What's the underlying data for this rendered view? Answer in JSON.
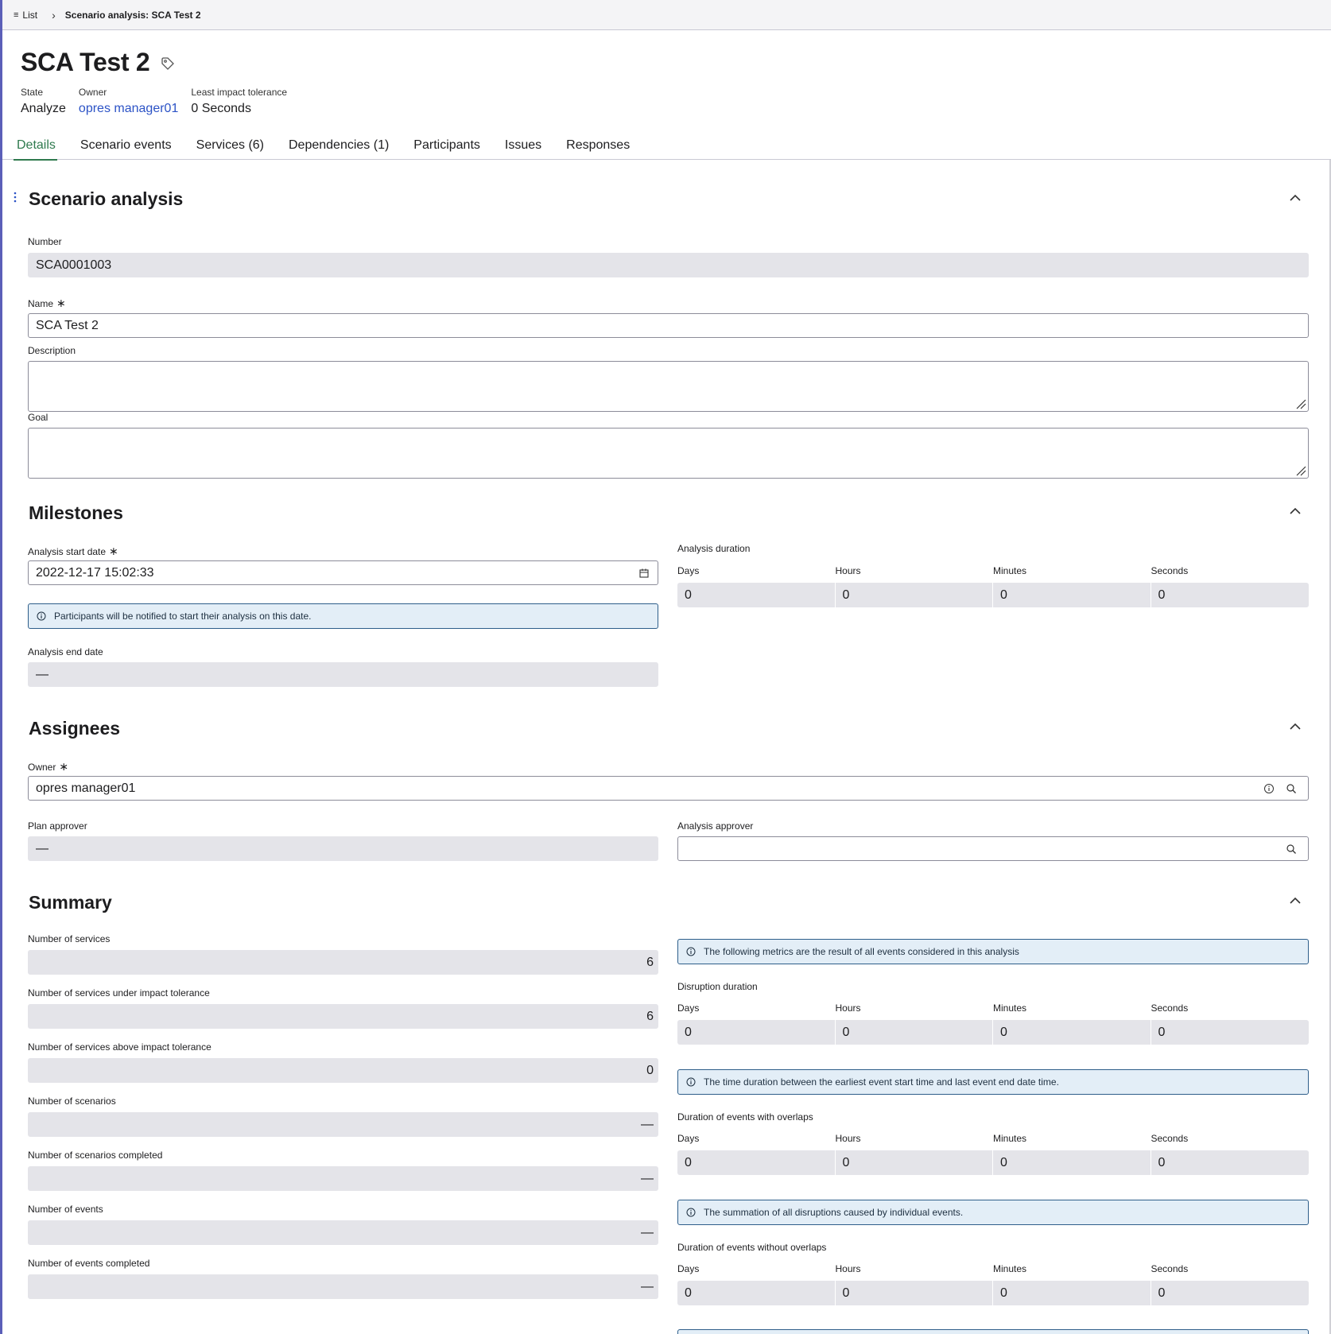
{
  "breadcrumb": {
    "list_label": "List",
    "current": "Scenario analysis: SCA Test 2"
  },
  "header": {
    "title": "SCA Test 2",
    "meta": [
      {
        "label": "State",
        "value": "Analyze"
      },
      {
        "label": "Owner",
        "value": "opres manager01"
      },
      {
        "label": "Least impact tolerance",
        "value": "0 Seconds"
      }
    ]
  },
  "tabs": [
    "Details",
    "Scenario events",
    "Services (6)",
    "Dependencies (1)",
    "Participants",
    "Issues",
    "Responses"
  ],
  "scenario_analysis": {
    "title": "Scenario analysis",
    "number_label": "Number",
    "number_value": "SCA0001003",
    "name_label": "Name",
    "name_value": "SCA Test 2",
    "description_label": "Description",
    "goal_label": "Goal"
  },
  "milestones": {
    "title": "Milestones",
    "start_label": "Analysis start date",
    "start_value": "2022-12-17 15:02:33",
    "start_info": "Participants will be notified to start their analysis on this date.",
    "end_label": "Analysis end date",
    "end_value": "—",
    "duration_label": "Analysis duration",
    "duration_units": [
      "Days",
      "Hours",
      "Minutes",
      "Seconds"
    ],
    "duration_values": [
      "0",
      "0",
      "0",
      "0"
    ]
  },
  "assignees": {
    "title": "Assignees",
    "owner_label": "Owner",
    "owner_value": "opres manager01",
    "plan_approver_label": "Plan approver",
    "plan_approver_value": "—",
    "analysis_approver_label": "Analysis approver",
    "analysis_approver_value": ""
  },
  "summary": {
    "title": "Summary",
    "fields": [
      {
        "label": "Number of services",
        "value": "6"
      },
      {
        "label": "Number of services under impact tolerance",
        "value": "6"
      },
      {
        "label": "Number of services above impact tolerance",
        "value": "0"
      },
      {
        "label": "Number of scenarios",
        "value": "—"
      },
      {
        "label": "Number of scenarios completed",
        "value": "—"
      },
      {
        "label": "Number of events",
        "value": "—"
      },
      {
        "label": "Number of events completed",
        "value": "—"
      }
    ],
    "metrics_info": "The following metrics are the result of all events considered in this analysis",
    "disruption_label": "Disruption duration",
    "disruption_values": [
      "0",
      "0",
      "0",
      "0"
    ],
    "disruption_info": "The time duration between the earliest event start time and last event end date time.",
    "overlaps_label": "Duration of events with overlaps",
    "overlaps_values": [
      "0",
      "0",
      "0",
      "0"
    ],
    "overlaps_info": "The summation of all disruptions caused by individual events.",
    "no_overlaps_label": "Duration of events without overlaps",
    "no_overlaps_values": [
      "0",
      "0",
      "0",
      "0"
    ],
    "units": [
      "Days",
      "Hours",
      "Minutes",
      "Seconds"
    ]
  }
}
